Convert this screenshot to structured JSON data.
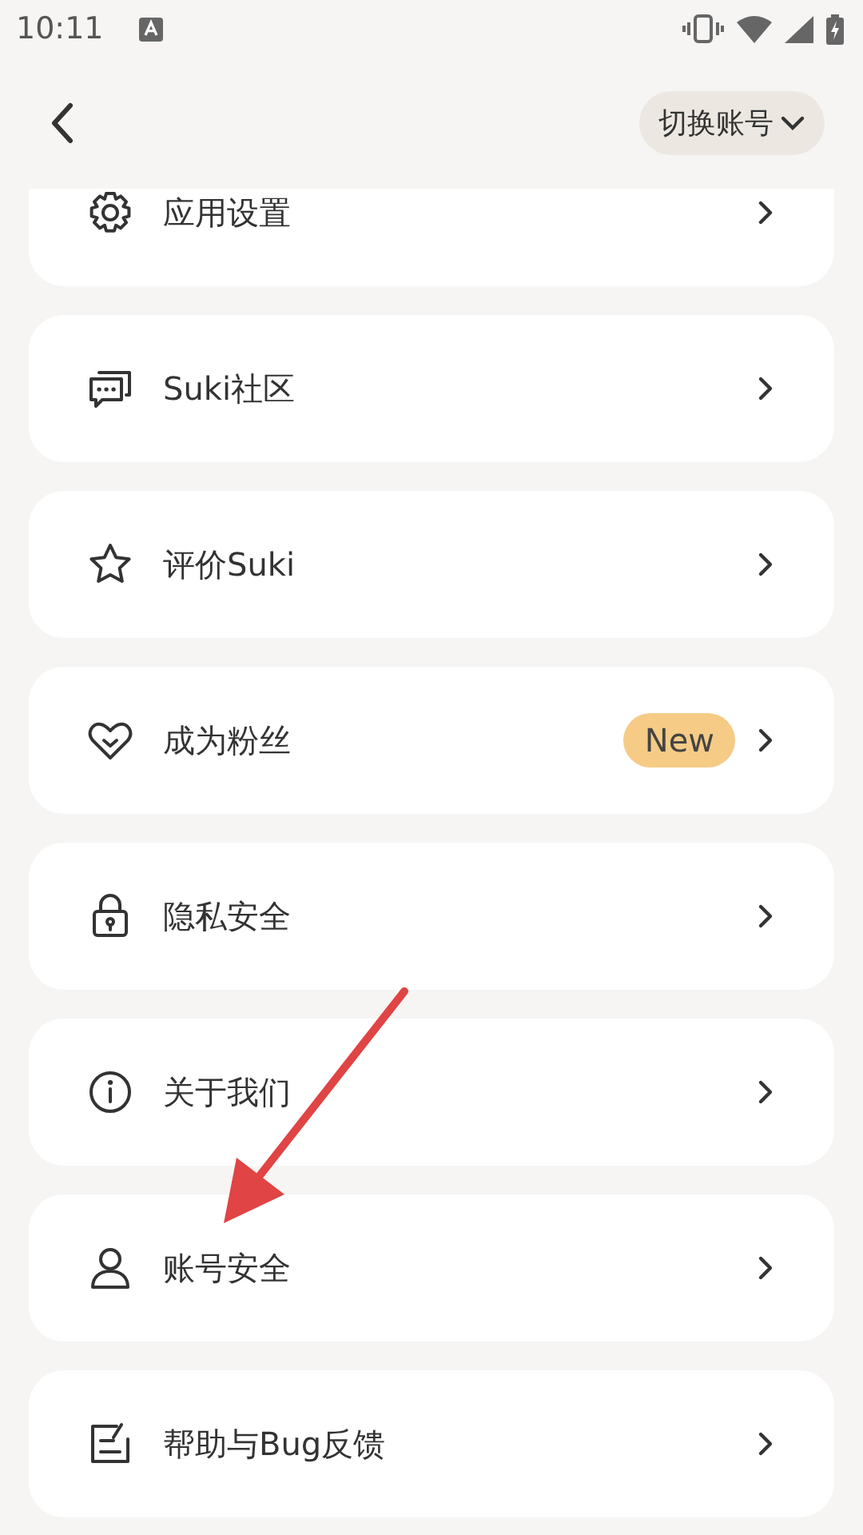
{
  "status_bar": {
    "time": "10:11"
  },
  "header": {
    "switch_account": "切换账号"
  },
  "items": [
    {
      "label": "应用设置"
    },
    {
      "label": "Suki社区"
    },
    {
      "label": "评价Suki"
    },
    {
      "label": "成为粉丝",
      "badge": "New"
    },
    {
      "label": "隐私安全"
    },
    {
      "label": "关于我们"
    },
    {
      "label": "账号安全"
    },
    {
      "label": "帮助与Bug反馈"
    }
  ]
}
